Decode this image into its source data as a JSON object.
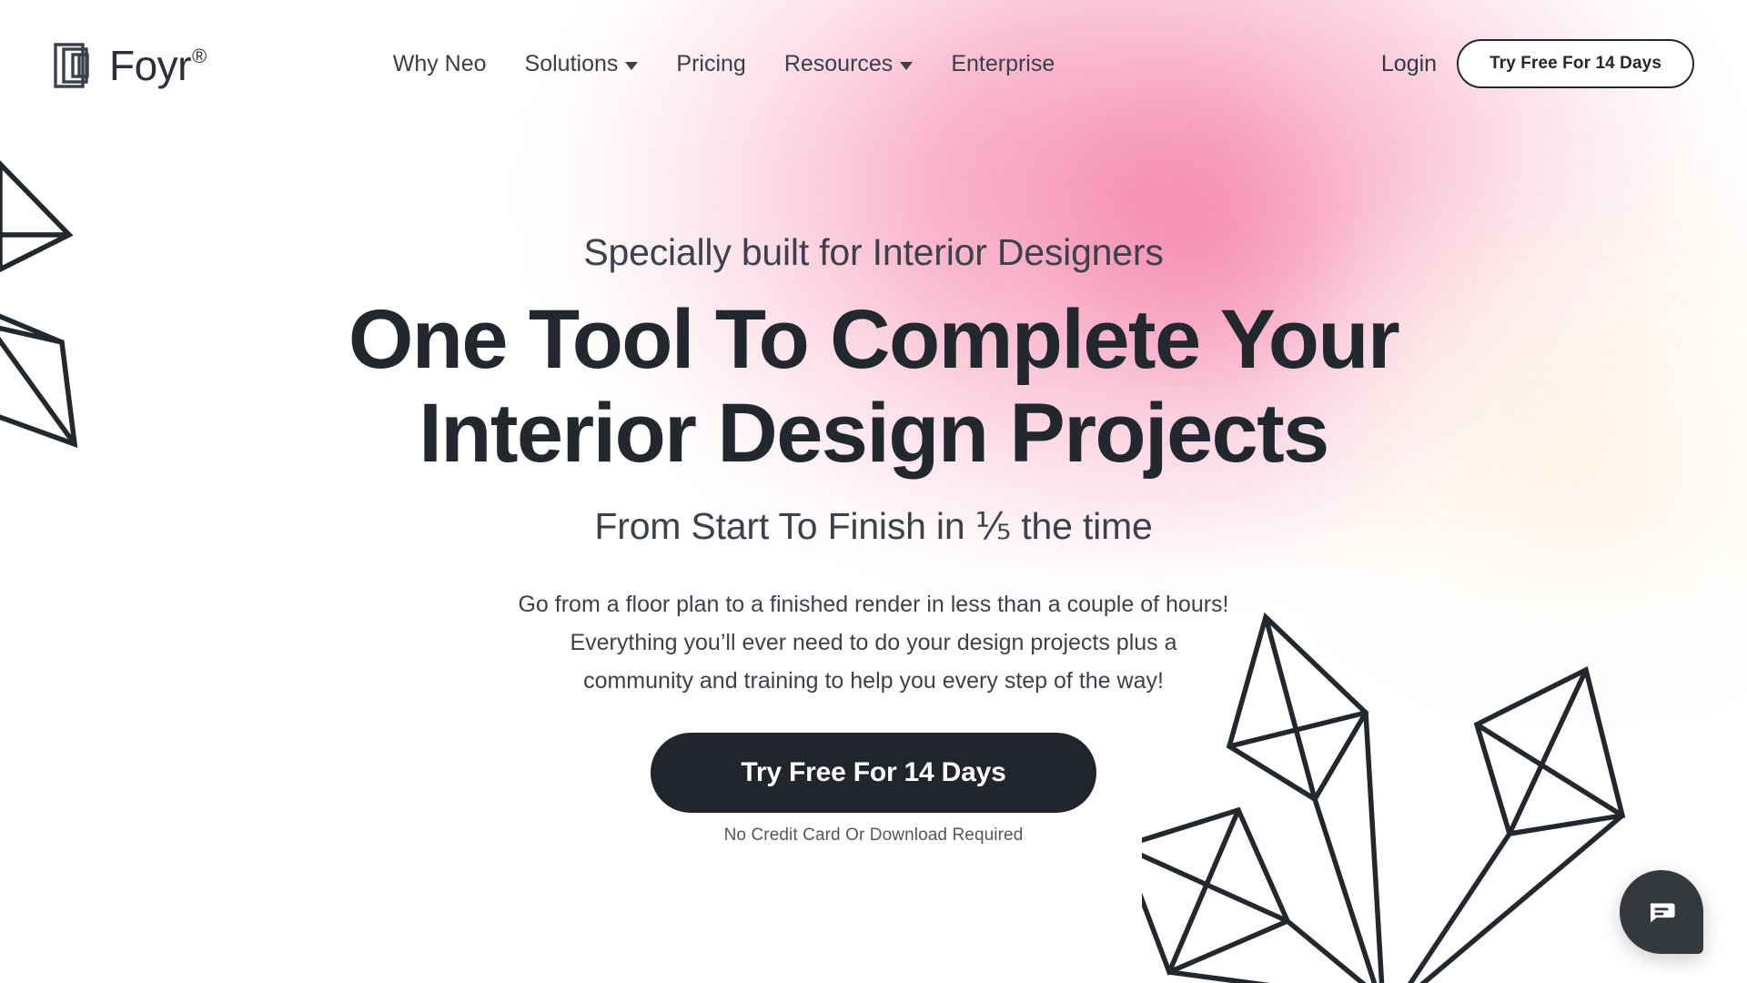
{
  "brand": {
    "name": "Foyr",
    "registered_mark": "®",
    "logo_icon": "foyr-layers-icon"
  },
  "nav": {
    "items": [
      {
        "label": "Why Neo",
        "has_dropdown": false
      },
      {
        "label": "Solutions",
        "has_dropdown": true
      },
      {
        "label": "Pricing",
        "has_dropdown": false
      },
      {
        "label": "Resources",
        "has_dropdown": true
      },
      {
        "label": "Enterprise",
        "has_dropdown": false
      }
    ],
    "login_label": "Login",
    "trial_button_label": "Try Free For 14 Days"
  },
  "hero": {
    "eyebrow": "Specially built for Interior Designers",
    "headline_line_1": "One Tool To Complete Your",
    "headline_line_2": "Interior Design Projects",
    "subheadline": "From Start To Finish in ⅕ the time",
    "paragraph": "Go from a floor plan to a finished render in less than a couple of hours! Everything you’ll ever need to do your design projects plus a community and training to help you every step of the way!",
    "cta_label": "Try Free For 14 Days",
    "cta_note": "No Credit Card Or Download Required"
  },
  "chat": {
    "icon": "chat-bubble-icon",
    "aria_label": "Open chat"
  },
  "decor": {
    "left_illustration": "geometric-leaf-line-art",
    "right_illustration": "geometric-plant-line-art"
  },
  "colors": {
    "ink": "#23282f",
    "body_text": "#3c414a",
    "accent_pink": "#f58bb0",
    "cta_dark": "#22262c",
    "page_bg": "#ffffff"
  }
}
